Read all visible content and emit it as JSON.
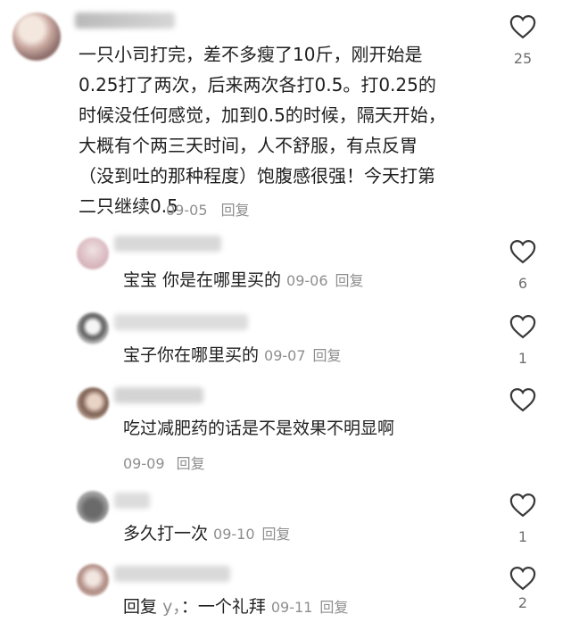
{
  "main_comment": {
    "username": "椰…_…",
    "text": "一只小司打完，差不多瘦了10斤，刚开始是\n0.25打了两次，后来两次各打0.5。打0.25的\n时候没任何感觉，加到0.5的时候，隔天开始，\n大概有个两三天时间，人不舒服，有点反胃\n（没到吐的那种程度）饱腹感很强！今天打第\n二只继续0.5",
    "date": "09-05",
    "reply_label": "回复",
    "likes": "25"
  },
  "replies": [
    {
      "username": "…",
      "text": "宝宝 你是在哪里买的",
      "date": "09-06",
      "reply_label": "回复",
      "likes": "6"
    },
    {
      "username": "…",
      "text": "宝子你在哪里买的",
      "date": "09-07",
      "reply_label": "回复",
      "likes": "1"
    },
    {
      "username": "…",
      "text": "吃过减肥药的话是不是效果不明显啊",
      "date": "09-09",
      "reply_label": "回复",
      "likes": ""
    },
    {
      "username": "…",
      "text": "多久打一次",
      "date": "09-10",
      "reply_label": "回复",
      "likes": "1"
    },
    {
      "username": "…",
      "prefix": "回复",
      "mention": "y，",
      "text": "：一个礼拜",
      "date": "09-11",
      "reply_label": "回复",
      "likes": "2"
    }
  ],
  "icons": {
    "like": "heart-outline-icon"
  },
  "colors": {
    "text": "#1f1f1f",
    "meta": "#8e8e8e",
    "icon": "#3a3a3a"
  }
}
